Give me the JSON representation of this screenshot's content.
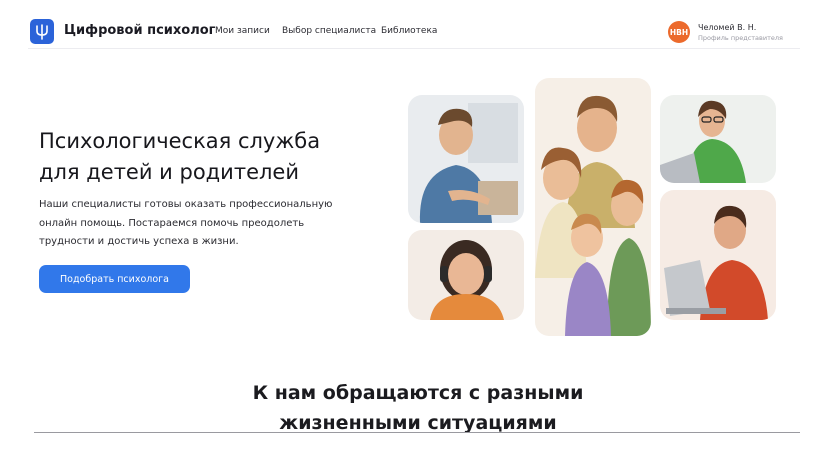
{
  "header": {
    "brand": "Цифровой психолог",
    "nav": [
      "Мои записи",
      "Выбор специалиста",
      "Библиотека"
    ],
    "user": {
      "initials": "НВН",
      "name": "Челомей В. Н.",
      "role": "Профиль представителя"
    }
  },
  "hero": {
    "title_line1": "Психологическая служба",
    "title_line2": "для детей и родителей",
    "text_line1": "Наши специалисты готовы оказать профессиональную",
    "text_line2": "онлайн помощь. Постараемся помочь преодолеть",
    "text_line3": "трудности и достичь успеха в жизни.",
    "cta_label": "Подобрать психолога"
  },
  "section": {
    "title_line1": "К нам обращаются с разными",
    "title_line2": "жизненными ситуациями"
  },
  "colors": {
    "accent": "#3178ea",
    "logo": "#2b63d9",
    "avatar": "#ec6a2c"
  },
  "icons": {
    "logo": "psyche-trident-icon"
  }
}
